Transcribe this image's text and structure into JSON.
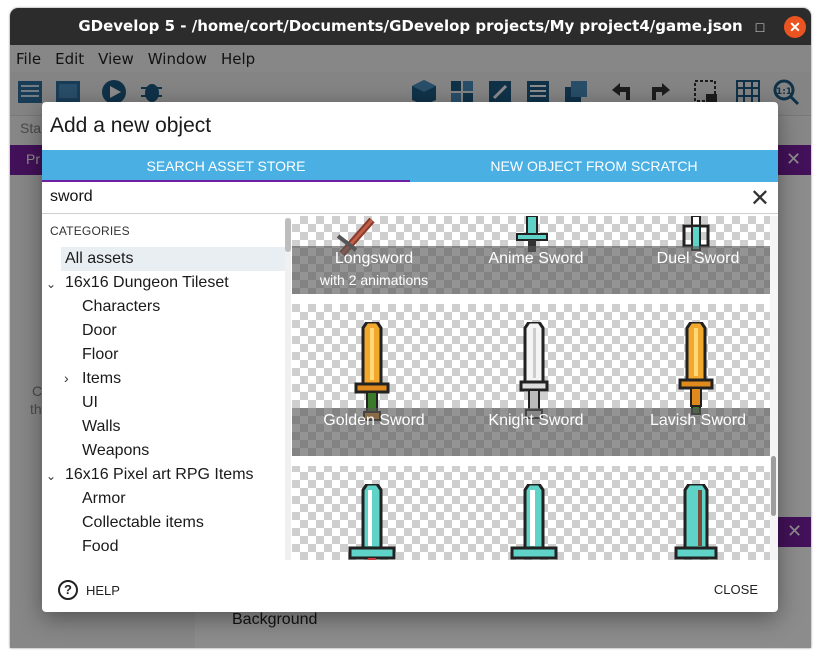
{
  "window": {
    "title": "GDevelop 5 - /home/cort/Documents/GDevelop projects/My project4/game.json",
    "minimize": "–",
    "maximize": "□",
    "close": "✕"
  },
  "menu": [
    "File",
    "Edit",
    "View",
    "Window",
    "Help"
  ],
  "background": {
    "start_text": "Sta",
    "tab_text": "Pr",
    "left_text_1": "C",
    "left_text_2": "th",
    "layer_name": "Background"
  },
  "dialog": {
    "title": "Add a new object",
    "tabs": [
      {
        "label": "SEARCH ASSET STORE",
        "active": true
      },
      {
        "label": "NEW OBJECT FROM SCRATCH",
        "active": false
      }
    ],
    "search": {
      "value": "sword"
    },
    "categories": {
      "header": "CATEGORIES",
      "items": [
        {
          "label": "All assets",
          "selected": true,
          "level": 0
        },
        {
          "label": "16x16 Dungeon Tileset",
          "expanded": true,
          "level": 0
        },
        {
          "label": "Characters",
          "level": 1
        },
        {
          "label": "Door",
          "level": 1
        },
        {
          "label": "Floor",
          "level": 1
        },
        {
          "label": "Items",
          "collapsed": true,
          "level": 1
        },
        {
          "label": "UI",
          "level": 1
        },
        {
          "label": "Walls",
          "level": 1
        },
        {
          "label": "Weapons",
          "level": 1
        },
        {
          "label": "16x16 Pixel art RPG Items",
          "expanded": true,
          "level": 0
        },
        {
          "label": "Armor",
          "level": 1
        },
        {
          "label": "Collectable items",
          "level": 1
        },
        {
          "label": "Food",
          "level": 1
        }
      ]
    },
    "assets": [
      {
        "name": "Longsword",
        "subtitle": "with 2 animations",
        "color": "#a0522d"
      },
      {
        "name": "Anime Sword",
        "subtitle": "",
        "color": "#5fd3c8"
      },
      {
        "name": "Duel Sword",
        "subtitle": "",
        "color": "#5fd3c8"
      },
      {
        "name": "Golden Sword",
        "subtitle": "",
        "color": "#f2a82c"
      },
      {
        "name": "Knight Sword",
        "subtitle": "",
        "color": "#f4f4f4"
      },
      {
        "name": "Lavish Sword",
        "subtitle": "",
        "color": "#f2a82c"
      },
      {
        "name": "",
        "subtitle": "",
        "color": "#5fd3c8"
      },
      {
        "name": "",
        "subtitle": "",
        "color": "#5fd3c8"
      },
      {
        "name": "",
        "subtitle": "",
        "color": "#5fd3c8"
      }
    ],
    "help_label": "HELP",
    "close_label": "CLOSE"
  },
  "colors": {
    "tab_bar": "#4ab0e4",
    "tab_indicator": "#6f1fa3",
    "accent_purple": "#7b1fa2",
    "titlebar": "#2c2c2c",
    "close_button": "#e95420"
  }
}
